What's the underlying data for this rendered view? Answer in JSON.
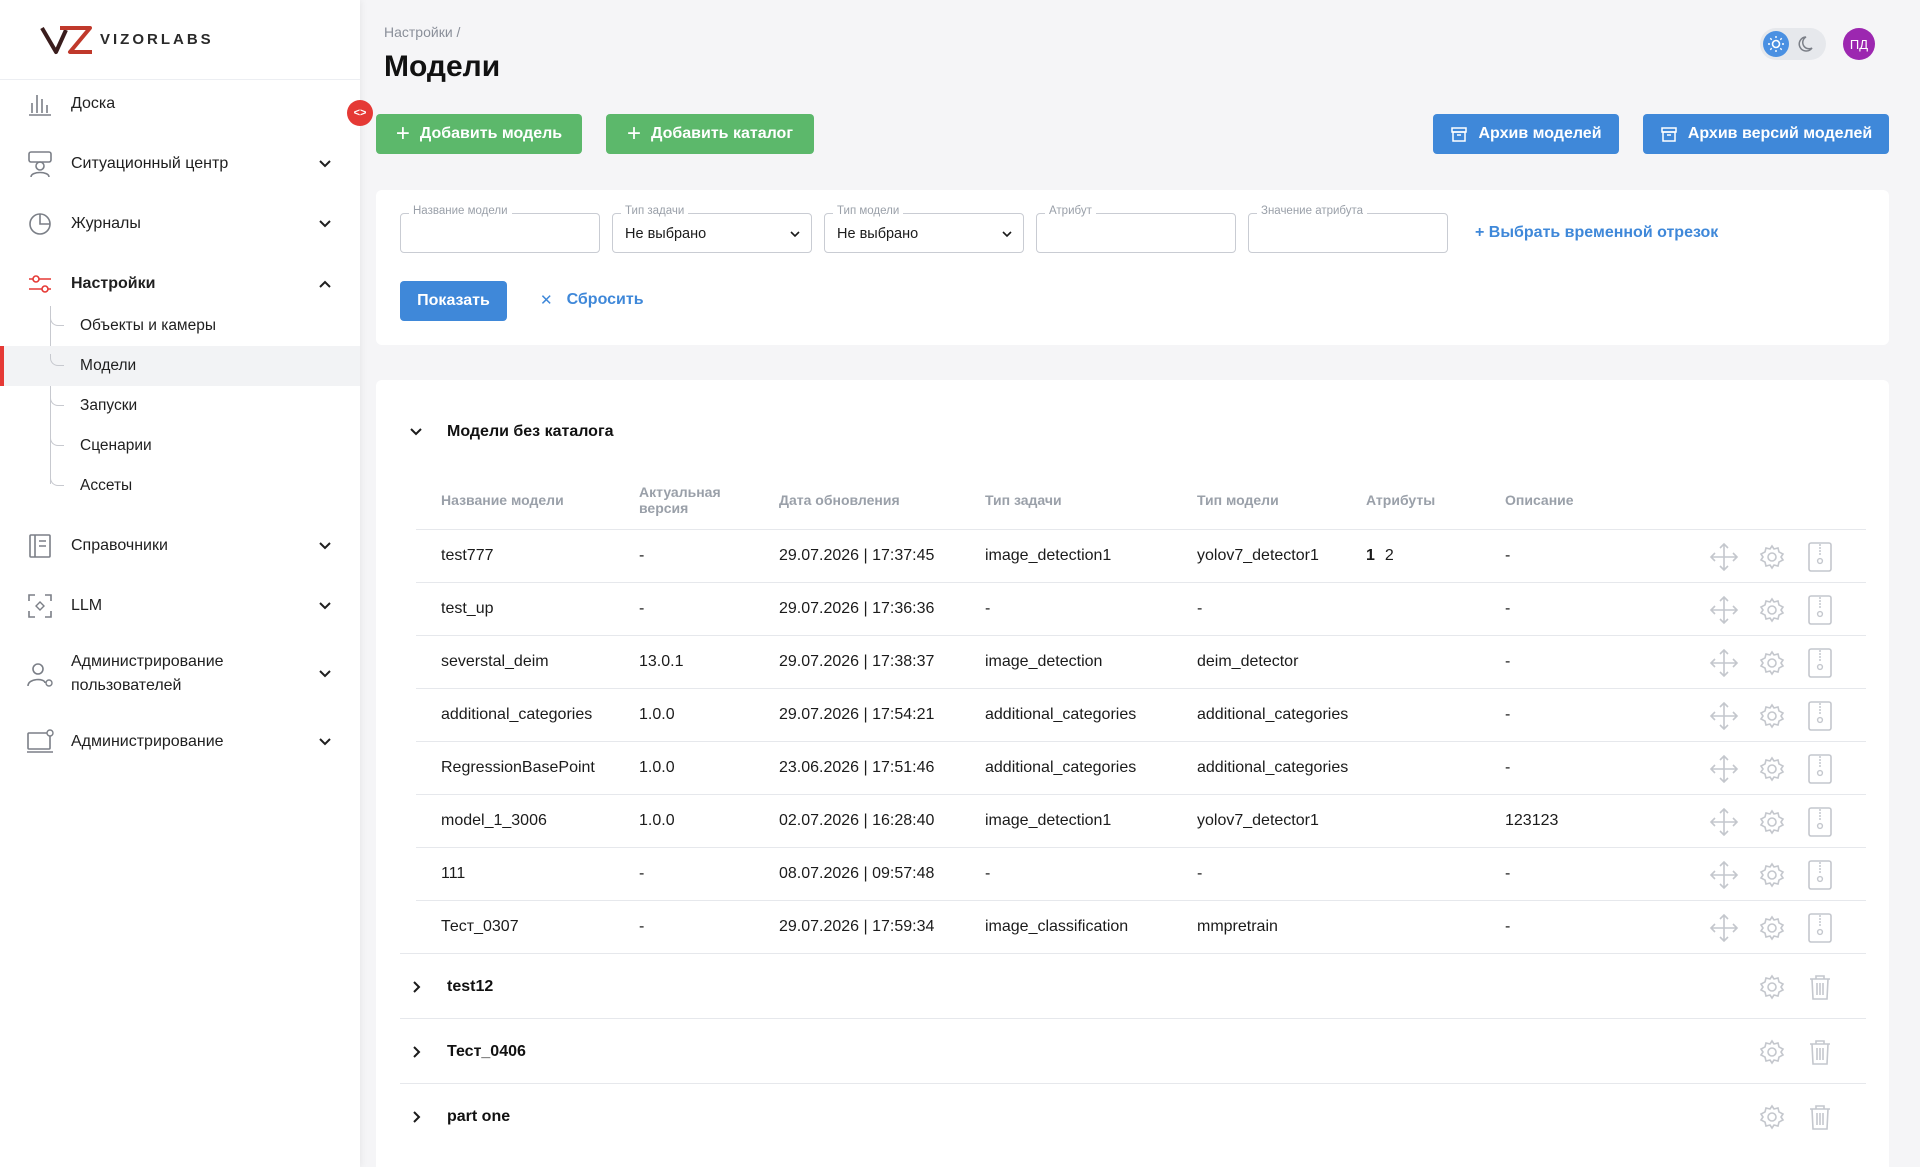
{
  "sidebar": {
    "logo_text": "VIZORLABS",
    "collapse_label": "<>",
    "items": [
      {
        "label": "Доска",
        "icon": "chart-bars-icon"
      },
      {
        "label": "Ситуационный центр",
        "icon": "operator-icon"
      },
      {
        "label": "Журналы",
        "icon": "pie-chart-icon"
      },
      {
        "label": "Настройки",
        "icon": "sliders-icon"
      },
      {
        "label": "Справочники",
        "icon": "book-icon"
      },
      {
        "label": "LLM",
        "icon": "ai-scan-icon"
      },
      {
        "label": "Администрирование\nпользователей",
        "label_line1": "Администрирование",
        "label_line2": "пользователей",
        "icon": "user-gear-icon"
      },
      {
        "label": "Администрирование",
        "icon": "monitor-gear-icon"
      }
    ],
    "settings_sub": [
      {
        "label": "Объекты и камеры"
      },
      {
        "label": "Модели"
      },
      {
        "label": "Запуски"
      },
      {
        "label": "Сценарии"
      },
      {
        "label": "Ассеты"
      }
    ]
  },
  "header": {
    "breadcrumb": "Настройки /",
    "title": "Модели",
    "avatar_initials": "ПД"
  },
  "toolbar": {
    "add_model": "Добавить модель",
    "add_catalog": "Добавить каталог",
    "models_archive": "Архив моделей",
    "versions_archive": "Архив версий моделей"
  },
  "filters": {
    "model_name": {
      "label": "Название модели",
      "value": ""
    },
    "task_type": {
      "label": "Тип задачи",
      "value": "Не выбрано"
    },
    "model_type": {
      "label": "Тип модели",
      "value": "Не выбрано"
    },
    "attribute": {
      "label": "Атрибут",
      "value": ""
    },
    "attribute_value": {
      "label": "Значение атрибута",
      "value": ""
    },
    "time_range_link": "+ Выбрать временной отрезок",
    "show_button": "Показать",
    "reset_button": "Сбросить"
  },
  "table": {
    "group_title": "Модели без каталога",
    "columns": {
      "name": "Название модели",
      "version_line1": "Актуальная",
      "version_line2": "версия",
      "date": "Дата обновления",
      "task": "Тип задачи",
      "type": "Тип модели",
      "attrs": "Атрибуты",
      "desc": "Описание"
    },
    "rows": [
      {
        "name": "test777",
        "version": "-",
        "date": "29.07.2026 | 17:37:45",
        "task": "image_detection1",
        "type": "yolov7_detector1",
        "attr1": "1",
        "attr2": "2",
        "desc": "-"
      },
      {
        "name": "test_up",
        "version": "-",
        "date": "29.07.2026 | 17:36:36",
        "task": "-",
        "type": "-",
        "attr1": "",
        "attr2": "",
        "desc": "-"
      },
      {
        "name": "severstal_deim",
        "version": "13.0.1",
        "date": "29.07.2026 | 17:38:37",
        "task": "image_detection",
        "type": "deim_detector",
        "attr1": "",
        "attr2": "",
        "desc": "-"
      },
      {
        "name": "additional_categories",
        "version": "1.0.0",
        "date": "29.07.2026 | 17:54:21",
        "task": "additional_categories",
        "type": "additional_categories",
        "attr1": "",
        "attr2": "",
        "desc": "-"
      },
      {
        "name": "RegressionBasePoint",
        "version": "1.0.0",
        "date": "23.06.2026 | 17:51:46",
        "task": "additional_categories",
        "type": "additional_categories",
        "attr1": "",
        "attr2": "",
        "desc": "-"
      },
      {
        "name": "model_1_3006",
        "version": "1.0.0",
        "date": "02.07.2026 | 16:28:40",
        "task": "image_detection1",
        "type": "yolov7_detector1",
        "attr1": "",
        "attr2": "",
        "desc": "123123"
      },
      {
        "name": "111",
        "version": "-",
        "date": "08.07.2026 | 09:57:48",
        "task": "-",
        "type": "-",
        "attr1": "",
        "attr2": "",
        "desc": "-"
      },
      {
        "name": "Тест_0307",
        "version": "-",
        "date": "29.07.2026 | 17:59:34",
        "task": "image_classification",
        "type": "mmpretrain",
        "attr1": "",
        "attr2": "",
        "desc": "-"
      }
    ],
    "catalogs": [
      {
        "name": "test12"
      },
      {
        "name": "Тест_0406"
      },
      {
        "name": "part one"
      }
    ]
  },
  "colors": {
    "accent_red": "#e53935",
    "green": "#5cb86b",
    "blue": "#3f88d9",
    "avatar": "#9c27b0"
  }
}
